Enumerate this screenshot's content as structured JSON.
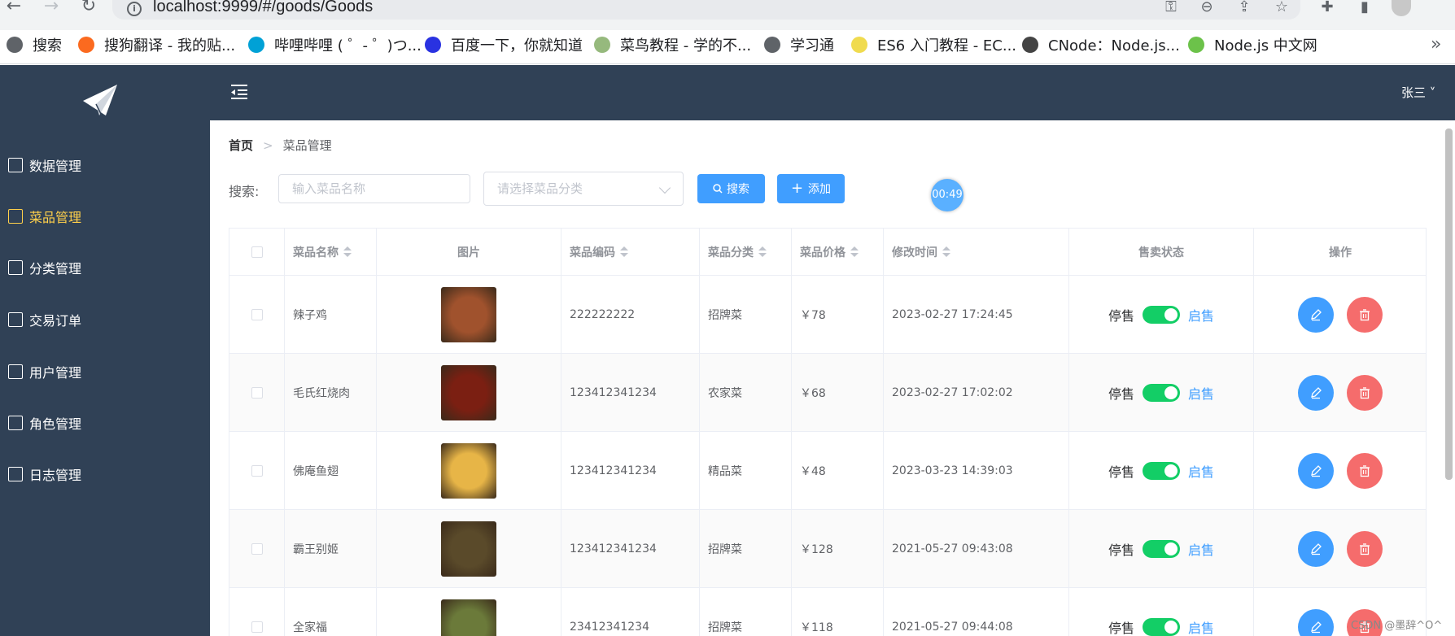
{
  "browser": {
    "url": "localhost:9999/#/goods/Goods",
    "bookmarks": [
      {
        "label": "搜索",
        "icon": "globe-icon",
        "color": "#5f6368"
      },
      {
        "label": "搜狗翻译 - 我的贴...",
        "icon": "sogou-icon",
        "color": "#fb6a1f"
      },
      {
        "label": "哔哩哔哩 ( ゜- ゜)つ...",
        "icon": "bilibili-icon",
        "color": "#00a1d6"
      },
      {
        "label": "百度一下，你就知道",
        "icon": "baidu-icon",
        "color": "#2932e1"
      },
      {
        "label": "菜鸟教程 - 学的不...",
        "icon": "runoob-icon",
        "color": "#96b97d"
      },
      {
        "label": "学习通",
        "icon": "globe-icon",
        "color": "#5f6368"
      },
      {
        "label": "ES6 入门教程 - EC...",
        "icon": "es6-icon",
        "color": "#f0db4f"
      },
      {
        "label": "CNode：Node.js...",
        "icon": "cnode-icon",
        "color": "#444"
      },
      {
        "label": "Node.js 中文网",
        "icon": "nodejs-icon",
        "color": "#6cc24a"
      }
    ],
    "more": "»"
  },
  "sidebar": {
    "items": [
      {
        "label": "数据管理",
        "active": false
      },
      {
        "label": "菜品管理",
        "active": true
      },
      {
        "label": "分类管理",
        "active": false
      },
      {
        "label": "交易订单",
        "active": false
      },
      {
        "label": "用户管理",
        "active": false
      },
      {
        "label": "角色管理",
        "active": false
      },
      {
        "label": "日志管理",
        "active": false
      }
    ]
  },
  "header": {
    "user": "张三 ˅"
  },
  "breadcrumb": {
    "home": "首页",
    "current": "菜品管理"
  },
  "toolbar": {
    "search_label": "搜索:",
    "name_placeholder": "输入菜品名称",
    "category_placeholder": "请选择菜品分类",
    "search_button": "搜索",
    "add_button": "添加",
    "timer": "00:49"
  },
  "table": {
    "columns": [
      "菜品名称",
      "图片",
      "菜品编码",
      "菜品分类",
      "菜品价格",
      "修改时间",
      "售卖状态",
      "操作"
    ],
    "rows": [
      {
        "name": "辣子鸡",
        "code": "222222222",
        "category": "招牌菜",
        "price": "￥78",
        "time": "2023-02-27 17:24:45",
        "off": "停售",
        "on": "启售",
        "img_color": "#a0522d"
      },
      {
        "name": "毛氏红烧肉",
        "code": "123412341234",
        "category": "农家菜",
        "price": "￥68",
        "time": "2023-02-27 17:02:02",
        "off": "停售",
        "on": "启售",
        "img_color": "#7b1f12"
      },
      {
        "name": "佛庵鱼翅",
        "code": "123412341234",
        "category": "精品菜",
        "price": "￥48",
        "time": "2023-03-23 14:39:03",
        "off": "停售",
        "on": "启售",
        "img_color": "#e7b547"
      },
      {
        "name": "霸王别姬",
        "code": "123412341234",
        "category": "招牌菜",
        "price": "￥128",
        "time": "2021-05-27 09:43:08",
        "off": "停售",
        "on": "启售",
        "img_color": "#5a4a2a"
      },
      {
        "name": "全家福",
        "code": "23412341234",
        "category": "招牌菜",
        "price": "￥118",
        "time": "2021-05-27 09:44:08",
        "off": "停售",
        "on": "启售",
        "img_color": "#6b7a3a"
      }
    ]
  },
  "watermark": "CSDN @墨辞^O^"
}
